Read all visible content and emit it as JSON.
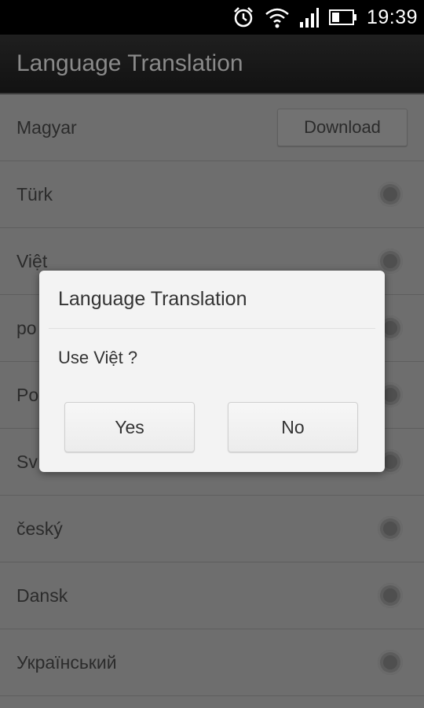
{
  "status_bar": {
    "time": "19:39",
    "icons": [
      "alarm-icon",
      "wifi-icon",
      "signal-icon",
      "battery-icon"
    ]
  },
  "action_bar": {
    "title": "Language Translation"
  },
  "list": {
    "items": [
      {
        "label": "Magyar",
        "action": "Download"
      },
      {
        "label": "Türk"
      },
      {
        "label": "Việt"
      },
      {
        "label": "po"
      },
      {
        "label": "Po"
      },
      {
        "label": "Sv"
      },
      {
        "label": "český"
      },
      {
        "label": "Dansk"
      },
      {
        "label": "Український"
      }
    ]
  },
  "dialog": {
    "title": "Language Translation",
    "message": "Use Việt ?",
    "yes_label": "Yes",
    "no_label": "No"
  }
}
